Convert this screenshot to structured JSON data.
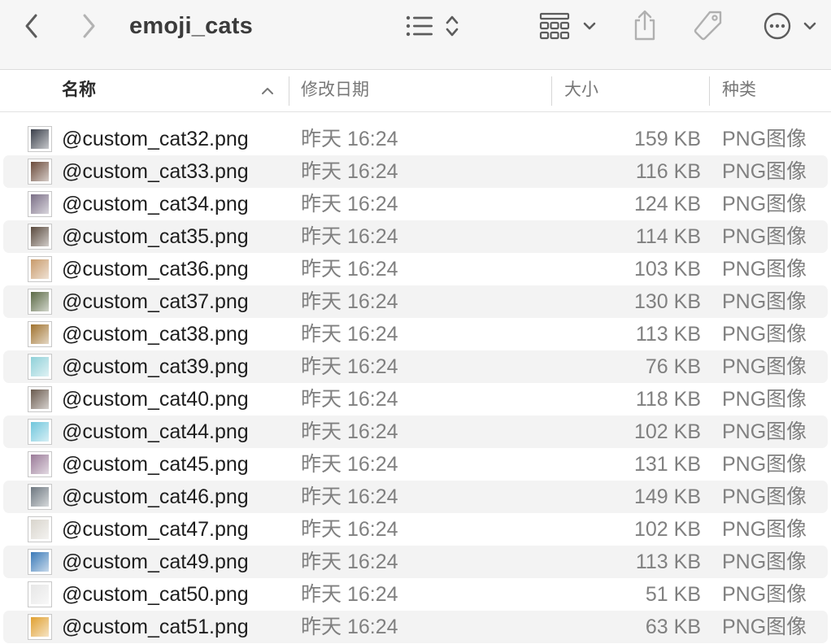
{
  "window": {
    "title": "emoji_cats"
  },
  "toolbar": {
    "back_icon": "chevron-left-icon",
    "forward_icon": "chevron-right-icon",
    "view_icon": "list-view-icon",
    "sort_icon": "up-down-chevron-icon",
    "group_icon": "grid-group-icon",
    "share_icon": "share-icon",
    "tag_icon": "tag-icon",
    "more_icon": "ellipsis-circle-icon"
  },
  "columns": {
    "name": "名称",
    "date": "修改日期",
    "size": "大小",
    "kind": "种类",
    "sort_direction": "ascending"
  },
  "files": [
    {
      "name": "@custom_cat32.png",
      "date": "昨天 16:24",
      "size": "159 KB",
      "kind": "PNG图像",
      "thumb_color": "#3a3f4a"
    },
    {
      "name": "@custom_cat33.png",
      "date": "昨天 16:24",
      "size": "116 KB",
      "kind": "PNG图像",
      "thumb_color": "#6b4a3a"
    },
    {
      "name": "@custom_cat34.png",
      "date": "昨天 16:24",
      "size": "124 KB",
      "kind": "PNG图像",
      "thumb_color": "#7a6e86"
    },
    {
      "name": "@custom_cat35.png",
      "date": "昨天 16:24",
      "size": "114 KB",
      "kind": "PNG图像",
      "thumb_color": "#5a4a3e"
    },
    {
      "name": "@custom_cat36.png",
      "date": "昨天 16:24",
      "size": "103 KB",
      "kind": "PNG图像",
      "thumb_color": "#c89a6a"
    },
    {
      "name": "@custom_cat37.png",
      "date": "昨天 16:24",
      "size": "130 KB",
      "kind": "PNG图像",
      "thumb_color": "#5b6a45"
    },
    {
      "name": "@custom_cat38.png",
      "date": "昨天 16:24",
      "size": "113 KB",
      "kind": "PNG图像",
      "thumb_color": "#a0722e"
    },
    {
      "name": "@custom_cat39.png",
      "date": "昨天 16:24",
      "size": "76 KB",
      "kind": "PNG图像",
      "thumb_color": "#8fd0d8"
    },
    {
      "name": "@custom_cat40.png",
      "date": "昨天 16:24",
      "size": "118 KB",
      "kind": "PNG图像",
      "thumb_color": "#6a5a4e"
    },
    {
      "name": "@custom_cat44.png",
      "date": "昨天 16:24",
      "size": "102 KB",
      "kind": "PNG图像",
      "thumb_color": "#6fc6dc"
    },
    {
      "name": "@custom_cat45.png",
      "date": "昨天 16:24",
      "size": "131 KB",
      "kind": "PNG图像",
      "thumb_color": "#9a7a98"
    },
    {
      "name": "@custom_cat46.png",
      "date": "昨天 16:24",
      "size": "149 KB",
      "kind": "PNG图像",
      "thumb_color": "#6e7880"
    },
    {
      "name": "@custom_cat47.png",
      "date": "昨天 16:24",
      "size": "102 KB",
      "kind": "PNG图像",
      "thumb_color": "#d8d4cc"
    },
    {
      "name": "@custom_cat49.png",
      "date": "昨天 16:24",
      "size": "113 KB",
      "kind": "PNG图像",
      "thumb_color": "#3a7ab8"
    },
    {
      "name": "@custom_cat50.png",
      "date": "昨天 16:24",
      "size": "51 KB",
      "kind": "PNG图像",
      "thumb_color": "#e6e6e6"
    },
    {
      "name": "@custom_cat51.png",
      "date": "昨天 16:24",
      "size": "63 KB",
      "kind": "PNG图像",
      "thumb_color": "#e0a030"
    }
  ]
}
